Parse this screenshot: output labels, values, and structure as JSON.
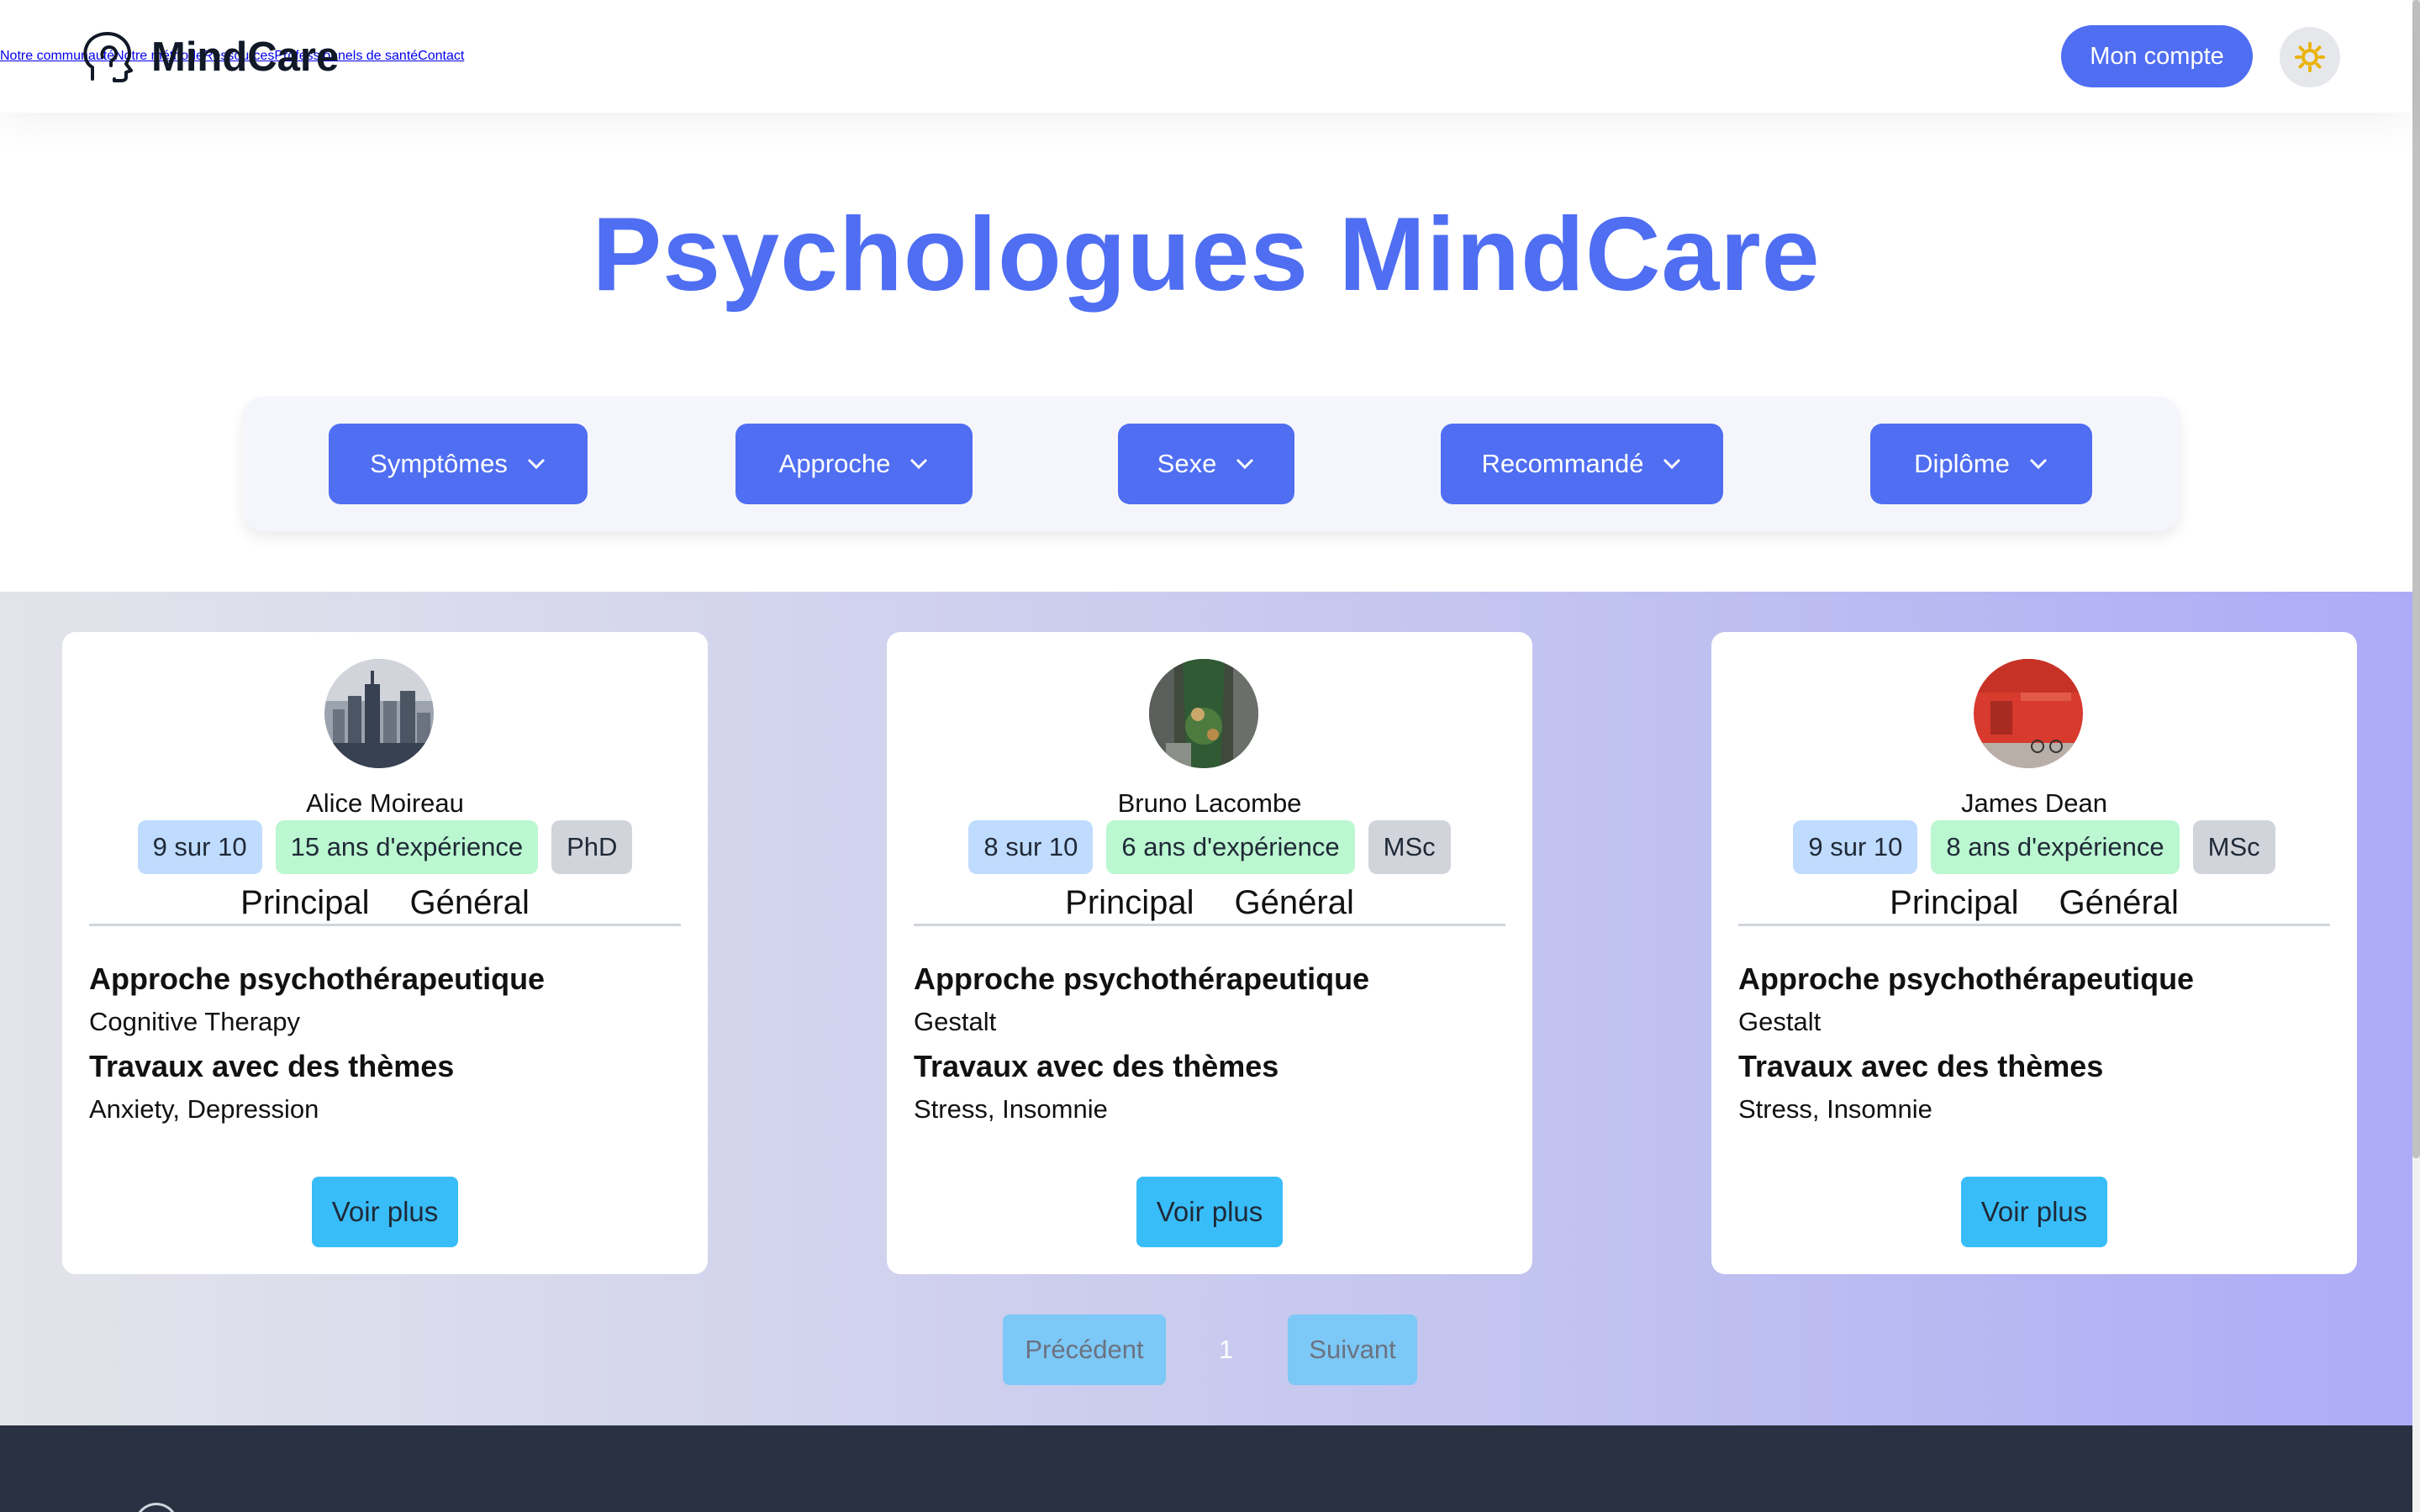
{
  "brand": {
    "name": "MindCare",
    "icon": "head-profile-icon"
  },
  "nav": {
    "links": [
      "Notre communauté",
      "Notre méthode",
      "Ressources",
      "Professionnels de santé",
      "Contact"
    ],
    "account_label": "Mon compte",
    "theme_icon": "sun-icon"
  },
  "title": "Psychologues MindCare",
  "filters": [
    "Symptômes",
    "Approche",
    "Sexe",
    "Recommandé",
    "Diplôme"
  ],
  "cards": [
    {
      "name": "Alice Moireau",
      "score": "9 sur 10",
      "experience": "15 ans d'expérience",
      "degree": "PhD",
      "tab_main": "Principal",
      "tab_general": "Général",
      "approach_heading": "Approche psychothérapeutique",
      "approach": "Cognitive Therapy",
      "themes_heading": "Travaux avec des thèmes",
      "themes": "Anxiety, Depression",
      "button": "Voir plus",
      "avatar": "city-skyline-photo"
    },
    {
      "name": "Bruno Lacombe",
      "score": "8 sur 10",
      "experience": "6 ans d'expérience",
      "degree": "MSc",
      "tab_main": "Principal",
      "tab_general": "Général",
      "approach_heading": "Approche psychothérapeutique",
      "approach": "Gestalt",
      "themes_heading": "Travaux avec des thèmes",
      "themes": "Stress, Insomnie",
      "button": "Voir plus",
      "avatar": "aerial-street-photo"
    },
    {
      "name": "James Dean",
      "score": "9 sur 10",
      "experience": "8 ans d'expérience",
      "degree": "MSc",
      "tab_main": "Principal",
      "tab_general": "Général",
      "approach_heading": "Approche psychothérapeutique",
      "approach": "Gestalt",
      "themes_heading": "Travaux avec des thèmes",
      "themes": "Stress, Insomnie",
      "button": "Voir plus",
      "avatar": "red-wall-photo"
    }
  ],
  "pagination": {
    "prev": "Précédent",
    "page": "1",
    "next": "Suivant"
  },
  "colors": {
    "primary": "#4f6ef2",
    "accent": "#38bdf8",
    "footer": "#2a3142"
  }
}
